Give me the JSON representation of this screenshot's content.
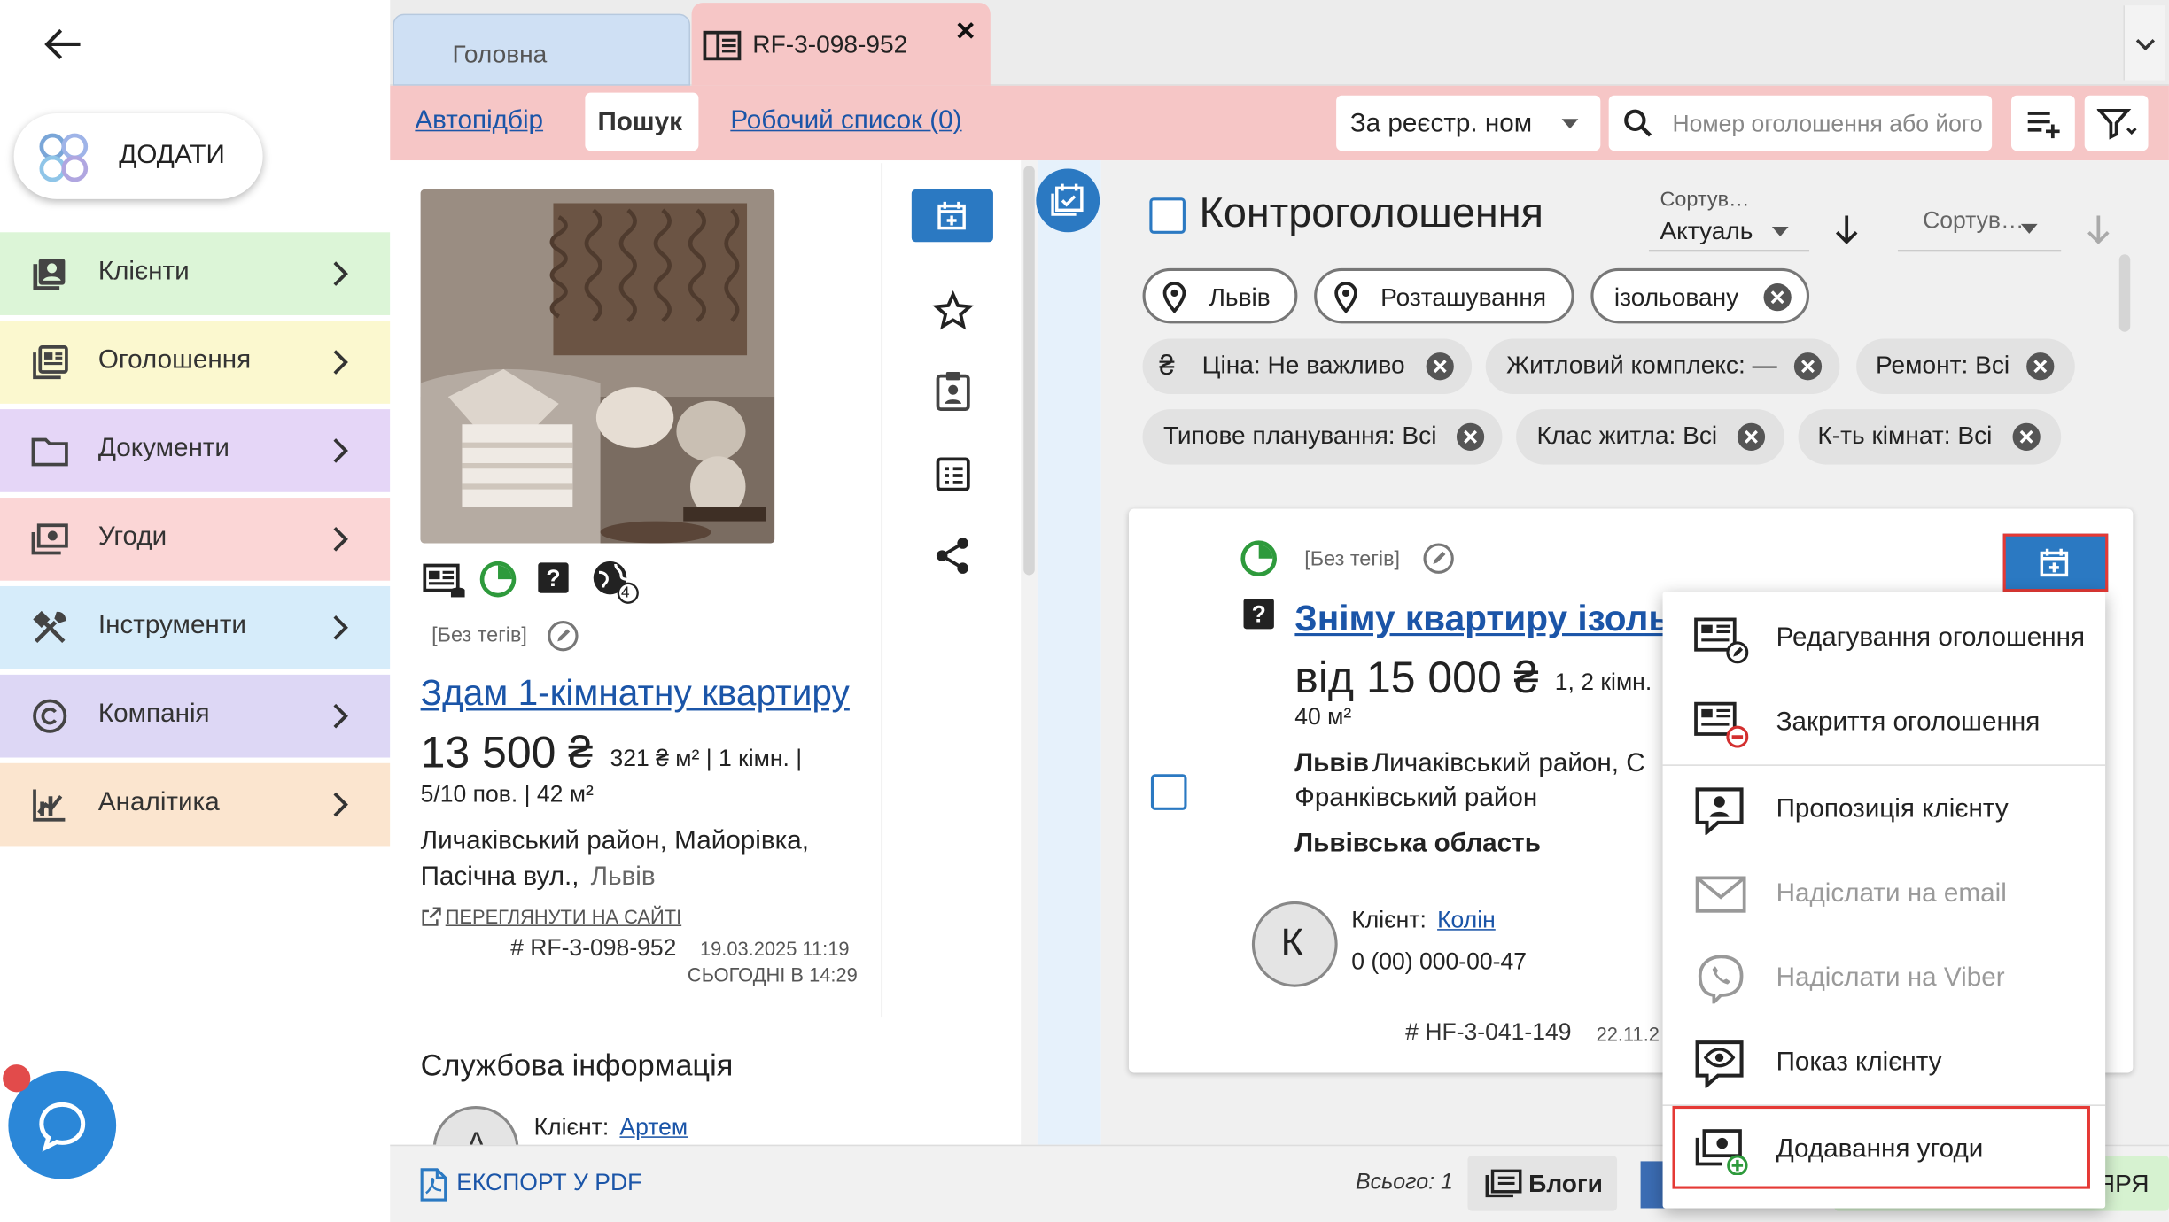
{
  "sidebar": {
    "add_label": "ДОДАТИ",
    "items": [
      {
        "label": "Клієнти",
        "icon": "clients-icon",
        "color": "#dcf5d7"
      },
      {
        "label": "Оголошення",
        "icon": "listings-icon",
        "color": "#fbf8cf"
      },
      {
        "label": "Документи",
        "icon": "folder-icon",
        "color": "#e5d6f7"
      },
      {
        "label": "Угоди",
        "icon": "deals-icon",
        "color": "#fbd6d6"
      },
      {
        "label": "Інструменти",
        "icon": "tools-icon",
        "color": "#d6ecfa"
      },
      {
        "label": "Компанія",
        "icon": "copyright-icon",
        "color": "#ddd7f5"
      },
      {
        "label": "Аналітика",
        "icon": "analytics-icon",
        "color": "#fbe5cf"
      }
    ]
  },
  "tabs": {
    "home": "Головна",
    "active": "RF-3-098-952"
  },
  "toolbar": {
    "autoselect": "Автопідбір",
    "search": "Пошук",
    "worklist": "Робочий список (0)",
    "select_value": "За реєстр. ном",
    "search_placeholder": "Номер оголошення або його"
  },
  "listing": {
    "tags": "[Без тегів]",
    "title": "Здам 1-кімнатну квартиру",
    "price": "13 500 ₴",
    "details1": "321 ₴ м² | 1 кімн. |",
    "details2": "5/10 пов. | 42 м²",
    "address1": "Личаківський район, Майорівка,",
    "address2": "Пасічна вул.,",
    "city": "Львів",
    "view_site": "ПЕРЕГЛЯНУТИ НА САЙТІ",
    "id": "# RF-3-098-952",
    "date1": "19.03.2025 11:19",
    "date2": "СЬОГОДНІ В 14:29",
    "globe_count": "4",
    "service_title": "Службова інформація",
    "client_label": "Клієнт:",
    "client_name": "Артем",
    "avatar_letter": "А"
  },
  "right": {
    "title": "Контроголошення",
    "sort1_label": "Сортув…",
    "sort1_value": "Актуаль",
    "sort2_label": "Сортув…",
    "chips": [
      {
        "text": "Львів",
        "icon": "pin"
      },
      {
        "text": "Розташування",
        "icon": "pin"
      },
      {
        "text": "ізольовану",
        "x": true
      },
      {
        "text": "Ціна: Не важливо",
        "icon": "hryvnia",
        "x": true
      },
      {
        "text": "Житловий комплекс: —",
        "x": true
      },
      {
        "text": "Ремонт: Всі",
        "x": true
      },
      {
        "text": "Типове планування: Всі",
        "x": true
      },
      {
        "text": "Клас житла: Всі",
        "x": true
      },
      {
        "text": "К-ть кімнат: Всі",
        "x": true
      }
    ],
    "card": {
      "tags": "[Без тегів]",
      "title": "Зніму квартиру ізольо",
      "price": "від 15 000 ₴",
      "rooms": "1, 2 кімн.",
      "area": "40 м²",
      "city": "Львів",
      "district": "Личаківський район, С",
      "district2": "Франківський район",
      "region": "Львівська область",
      "client_label": "Клієнт:",
      "client_name": "Колін",
      "phone": "0 (00) 000-00-47",
      "avatar_letter": "К",
      "id": "# HF-3-041-149",
      "date": "22.11.2"
    },
    "menu": [
      {
        "label": "Редагування оголошення",
        "disabled": false
      },
      {
        "label": "Закриття оголошення",
        "disabled": false
      },
      {
        "label": "Пропозиція клієнту",
        "disabled": false
      },
      {
        "label": "Надіслати на email",
        "disabled": true
      },
      {
        "label": "Надіслати на Viber",
        "disabled": true
      },
      {
        "label": "Показ клієнту",
        "disabled": false
      },
      {
        "label": "Додавання угоди",
        "disabled": false
      }
    ]
  },
  "bottom": {
    "export": "ЕКСПОРТ У PDF",
    "total": "Всього: 1",
    "blogs": "Блоги",
    "right_fragment": "ЯРЯ"
  },
  "colors": {
    "accent": "#2b79c2",
    "link": "#1b55a8",
    "highlight": "#e53935",
    "tab_active": "#f6c6c6"
  }
}
